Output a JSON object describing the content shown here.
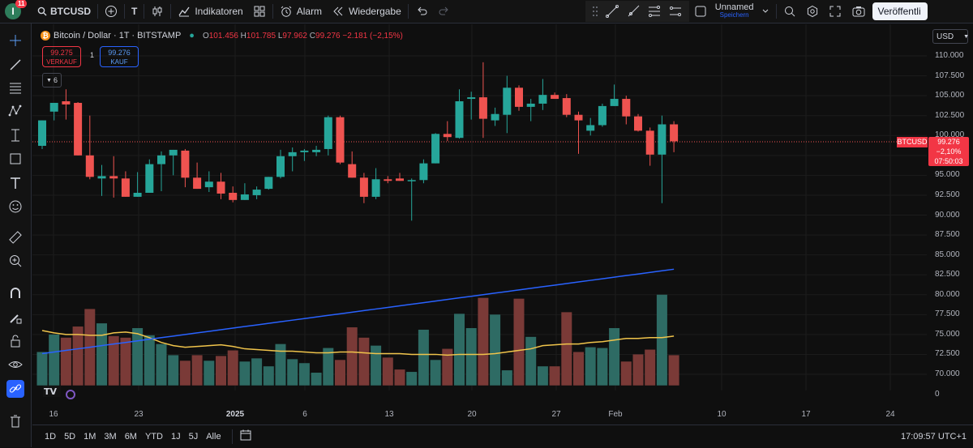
{
  "topbar": {
    "notifications": "11",
    "avatar_letter": "I",
    "symbol": "BTCUSD",
    "timeframe": "T",
    "indicators_label": "Indikatoren",
    "alarm_label": "Alarm",
    "replay_label": "Wiedergabe",
    "layout_name": "Unnamed",
    "layout_sub": "Speichern",
    "publish_label": "Veröffentli"
  },
  "legend": {
    "title": "Bitcoin / Dollar · 1T · BITSTAMP",
    "o_k": "O",
    "o": "101.456",
    "h_k": "H",
    "h": "101.785",
    "l_k": "L",
    "l": "97.962",
    "c_k": "C",
    "c": "99.276",
    "change": "−2.181 (−2,15%)"
  },
  "sell": {
    "price": "99.275",
    "label": "VERKAUF"
  },
  "buy": {
    "price": "99.276",
    "label": "KAUF"
  },
  "spread": "1",
  "indicator_count": "6",
  "currency": "USD",
  "price_tag": {
    "symbol": "BTCUSD",
    "price": "99.276",
    "change": "−2,10%",
    "countdown": "07:50:03"
  },
  "price_axis": [
    "110.000",
    "107.500",
    "105.000",
    "102.500",
    "100.000",
    "97.500",
    "95.000",
    "92.500",
    "90.000",
    "87.500",
    "85.000",
    "82.500",
    "80.000",
    "77.500",
    "75.000",
    "72.500",
    "70.000",
    "0"
  ],
  "time_axis": [
    "16",
    "23",
    "2025",
    "6",
    "13",
    "20",
    "27",
    "Feb",
    "10",
    "17",
    "24"
  ],
  "ranges": [
    "1D",
    "5D",
    "1M",
    "3M",
    "6M",
    "YTD",
    "1J",
    "5J",
    "Alle"
  ],
  "clock": "17:09:57 UTC+1",
  "colors": {
    "up": "#26a69a",
    "down": "#ef5350",
    "ma_blue": "#2962ff",
    "ma_yellow": "#f0c44b"
  },
  "chart_data": {
    "type": "candlestick",
    "title": "Bitcoin / Dollar · 1T · BITSTAMP",
    "ylim": [
      90000,
      110000
    ],
    "candles": [
      {
        "o": 98700,
        "h": 101800,
        "l": 98300,
        "c": 101900
      },
      {
        "o": 103000,
        "h": 104000,
        "l": 101900,
        "c": 104100
      },
      {
        "o": 104300,
        "h": 105800,
        "l": 102000,
        "c": 103900
      },
      {
        "o": 104100,
        "h": 104200,
        "l": 100200,
        "c": 97500
      },
      {
        "o": 97500,
        "h": 102500,
        "l": 94500,
        "c": 94800
      },
      {
        "o": 94600,
        "h": 96300,
        "l": 92400,
        "c": 94900
      },
      {
        "o": 94900,
        "h": 97400,
        "l": 92200,
        "c": 94600
      },
      {
        "o": 94600,
        "h": 95500,
        "l": 93200,
        "c": 92300
      },
      {
        "o": 92300,
        "h": 95400,
        "l": 92600,
        "c": 92800
      },
      {
        "o": 92800,
        "h": 97000,
        "l": 93000,
        "c": 96400
      },
      {
        "o": 96400,
        "h": 98000,
        "l": 93000,
        "c": 97500
      },
      {
        "o": 97500,
        "h": 98100,
        "l": 95000,
        "c": 98200
      },
      {
        "o": 98100,
        "h": 98300,
        "l": 93500,
        "c": 94700
      },
      {
        "o": 94700,
        "h": 96600,
        "l": 93400,
        "c": 93300
      },
      {
        "o": 93500,
        "h": 95500,
        "l": 92900,
        "c": 94200
      },
      {
        "o": 94200,
        "h": 95300,
        "l": 92000,
        "c": 92700
      },
      {
        "o": 92800,
        "h": 93600,
        "l": 91600,
        "c": 91900
      },
      {
        "o": 91900,
        "h": 94000,
        "l": 92300,
        "c": 92600
      },
      {
        "o": 92500,
        "h": 93600,
        "l": 92000,
        "c": 93200
      },
      {
        "o": 93300,
        "h": 94600,
        "l": 93200,
        "c": 94800
      },
      {
        "o": 94800,
        "h": 98200,
        "l": 94600,
        "c": 97400
      },
      {
        "o": 97400,
        "h": 98500,
        "l": 95500,
        "c": 97900
      },
      {
        "o": 97900,
        "h": 98300,
        "l": 96800,
        "c": 98100
      },
      {
        "o": 97900,
        "h": 98700,
        "l": 97400,
        "c": 98200
      },
      {
        "o": 98300,
        "h": 102500,
        "l": 97500,
        "c": 102300
      },
      {
        "o": 102300,
        "h": 102500,
        "l": 96400,
        "c": 96600
      },
      {
        "o": 96400,
        "h": 98000,
        "l": 94800,
        "c": 94700
      },
      {
        "o": 94700,
        "h": 95300,
        "l": 91500,
        "c": 92300
      },
      {
        "o": 92300,
        "h": 95900,
        "l": 92000,
        "c": 94500
      },
      {
        "o": 94500,
        "h": 94900,
        "l": 94000,
        "c": 94300
      },
      {
        "o": 94600,
        "h": 95300,
        "l": 94300,
        "c": 94300
      },
      {
        "o": 94300,
        "h": 94600,
        "l": 89300,
        "c": 94400
      },
      {
        "o": 94400,
        "h": 97000,
        "l": 94000,
        "c": 96500
      },
      {
        "o": 96500,
        "h": 100300,
        "l": 97000,
        "c": 100200
      },
      {
        "o": 100200,
        "h": 101800,
        "l": 99300,
        "c": 99800
      },
      {
        "o": 99700,
        "h": 105800,
        "l": 99600,
        "c": 104300
      },
      {
        "o": 104600,
        "h": 105500,
        "l": 102000,
        "c": 104800
      },
      {
        "o": 104800,
        "h": 109200,
        "l": 99700,
        "c": 102100
      },
      {
        "o": 101900,
        "h": 103500,
        "l": 101200,
        "c": 102700
      },
      {
        "o": 102600,
        "h": 107500,
        "l": 100300,
        "c": 106000
      },
      {
        "o": 106000,
        "h": 106300,
        "l": 103100,
        "c": 103600
      },
      {
        "o": 103600,
        "h": 104600,
        "l": 101800,
        "c": 104000
      },
      {
        "o": 104000,
        "h": 107100,
        "l": 103200,
        "c": 105100
      },
      {
        "o": 105100,
        "h": 105400,
        "l": 104600,
        "c": 104600
      },
      {
        "o": 104700,
        "h": 105200,
        "l": 102300,
        "c": 102600
      },
      {
        "o": 102600,
        "h": 103000,
        "l": 97700,
        "c": 101900
      },
      {
        "o": 100600,
        "h": 102200,
        "l": 100000,
        "c": 101300
      },
      {
        "o": 101300,
        "h": 104000,
        "l": 101100,
        "c": 103700
      },
      {
        "o": 103700,
        "h": 106400,
        "l": 104000,
        "c": 104600
      },
      {
        "o": 104600,
        "h": 105000,
        "l": 101400,
        "c": 102400
      },
      {
        "o": 102400,
        "h": 102700,
        "l": 100500,
        "c": 100600
      },
      {
        "o": 100600,
        "h": 101000,
        "l": 96200,
        "c": 97600
      },
      {
        "o": 97600,
        "h": 102500,
        "l": 91500,
        "c": 101400
      },
      {
        "o": 101400,
        "h": 101800,
        "l": 97900,
        "c": 99276
      }
    ],
    "ma_long": {
      "start": 72600,
      "end": 83200
    },
    "volume_ma": [
      75500,
      75200,
      75000,
      75000,
      74900,
      74900,
      75200,
      75300,
      75100,
      74600,
      74000,
      73600,
      73400,
      73500,
      73600,
      73700,
      73500,
      73200,
      73100,
      73000,
      72900,
      72900,
      72800,
      72700,
      72700,
      72800,
      72800,
      72700,
      72600,
      72600,
      72600,
      72500,
      72500,
      72500,
      72400,
      72500,
      72500,
      72500,
      72600,
      72800,
      73000,
      73200,
      73600,
      73700,
      73800,
      73800,
      74000,
      74100,
      74300,
      74500,
      74500,
      74600,
      74600,
      74800
    ],
    "volumes": [
      72800,
      75000,
      74600,
      76000,
      78200,
      76400,
      74800,
      74600,
      75800,
      74900,
      73800,
      72400,
      71700,
      72400,
      71700,
      72300,
      73000,
      71600,
      72000,
      71000,
      73800,
      71900,
      71400,
      70200,
      73300,
      71800,
      75900,
      74600,
      73600,
      72100,
      70600,
      70300,
      75600,
      71800,
      73200,
      77600,
      75800,
      79600,
      77500,
      70500,
      79500,
      74700,
      71000,
      71000,
      77800,
      72800,
      73400,
      73300,
      75800,
      71600,
      72500,
      73100,
      80000,
      72400
    ]
  }
}
